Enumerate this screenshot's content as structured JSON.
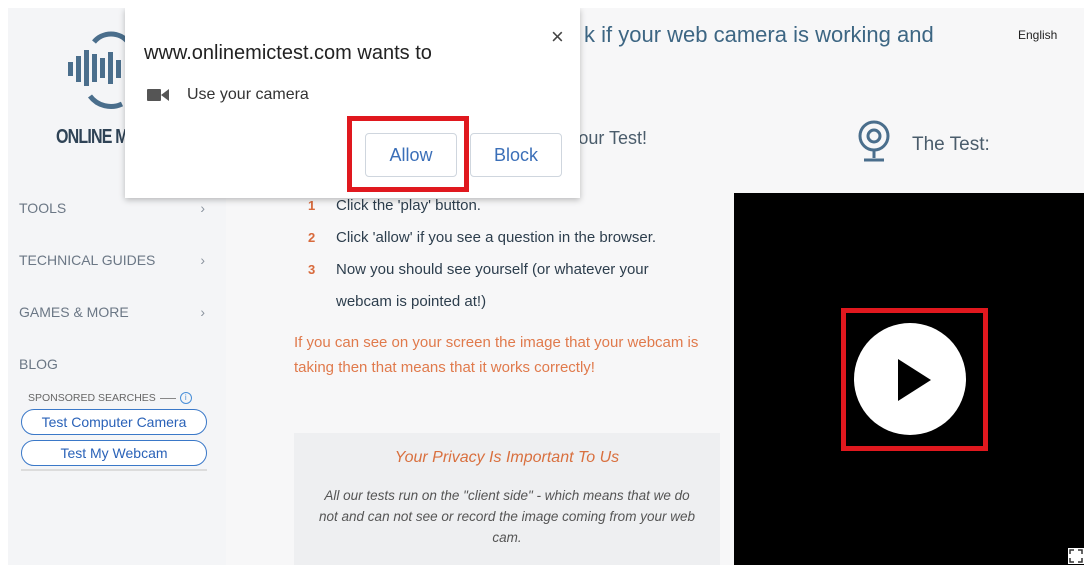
{
  "header": {
    "title_fragment": "k if your web camera is working and",
    "language": "English"
  },
  "sidebar": {
    "logo_text": "ONLINE M",
    "items": [
      {
        "label": "TOOLS"
      },
      {
        "label": "TECHNICAL GUIDES"
      },
      {
        "label": "GAMES & MORE"
      },
      {
        "label": "BLOG"
      }
    ],
    "sponsored_label": "SPONSORED SEARCHES",
    "sponsored_links": [
      "Test Computer Camera",
      "Test My Webcam"
    ]
  },
  "main": {
    "section_heading": "Your Test!",
    "test_heading": "The Test:",
    "steps": [
      {
        "num": "1",
        "text": "Click the 'play' button."
      },
      {
        "num": "2",
        "text": "Click 'allow' if you see a question in the browser."
      },
      {
        "num": "3",
        "text": "Now you should see yourself (or whatever your"
      },
      {
        "num": "",
        "text": "webcam is pointed at!)"
      }
    ],
    "info_text": "If you can see on your screen the image that your webcam is taking then that means that it works correctly!",
    "privacy": {
      "title": "Your Privacy Is Important To Us",
      "body": "All our tests run on the \"client side\" - which means that we do not and can not see or record the image coming from your web cam."
    }
  },
  "dialog": {
    "title": "www.onlinemictest.com wants to",
    "permission": "Use your camera",
    "allow_label": "Allow",
    "block_label": "Block",
    "close_symbol": "×"
  },
  "colors": {
    "highlight": "#e0181e",
    "accent_orange": "#e07a4c",
    "link_blue": "#3b6fb8"
  },
  "icons": [
    "microphone-logo-icon",
    "webcam-icon",
    "video-camera-icon",
    "play-icon",
    "close-icon",
    "chevron-right-icon",
    "info-icon",
    "fullscreen-icon"
  ]
}
